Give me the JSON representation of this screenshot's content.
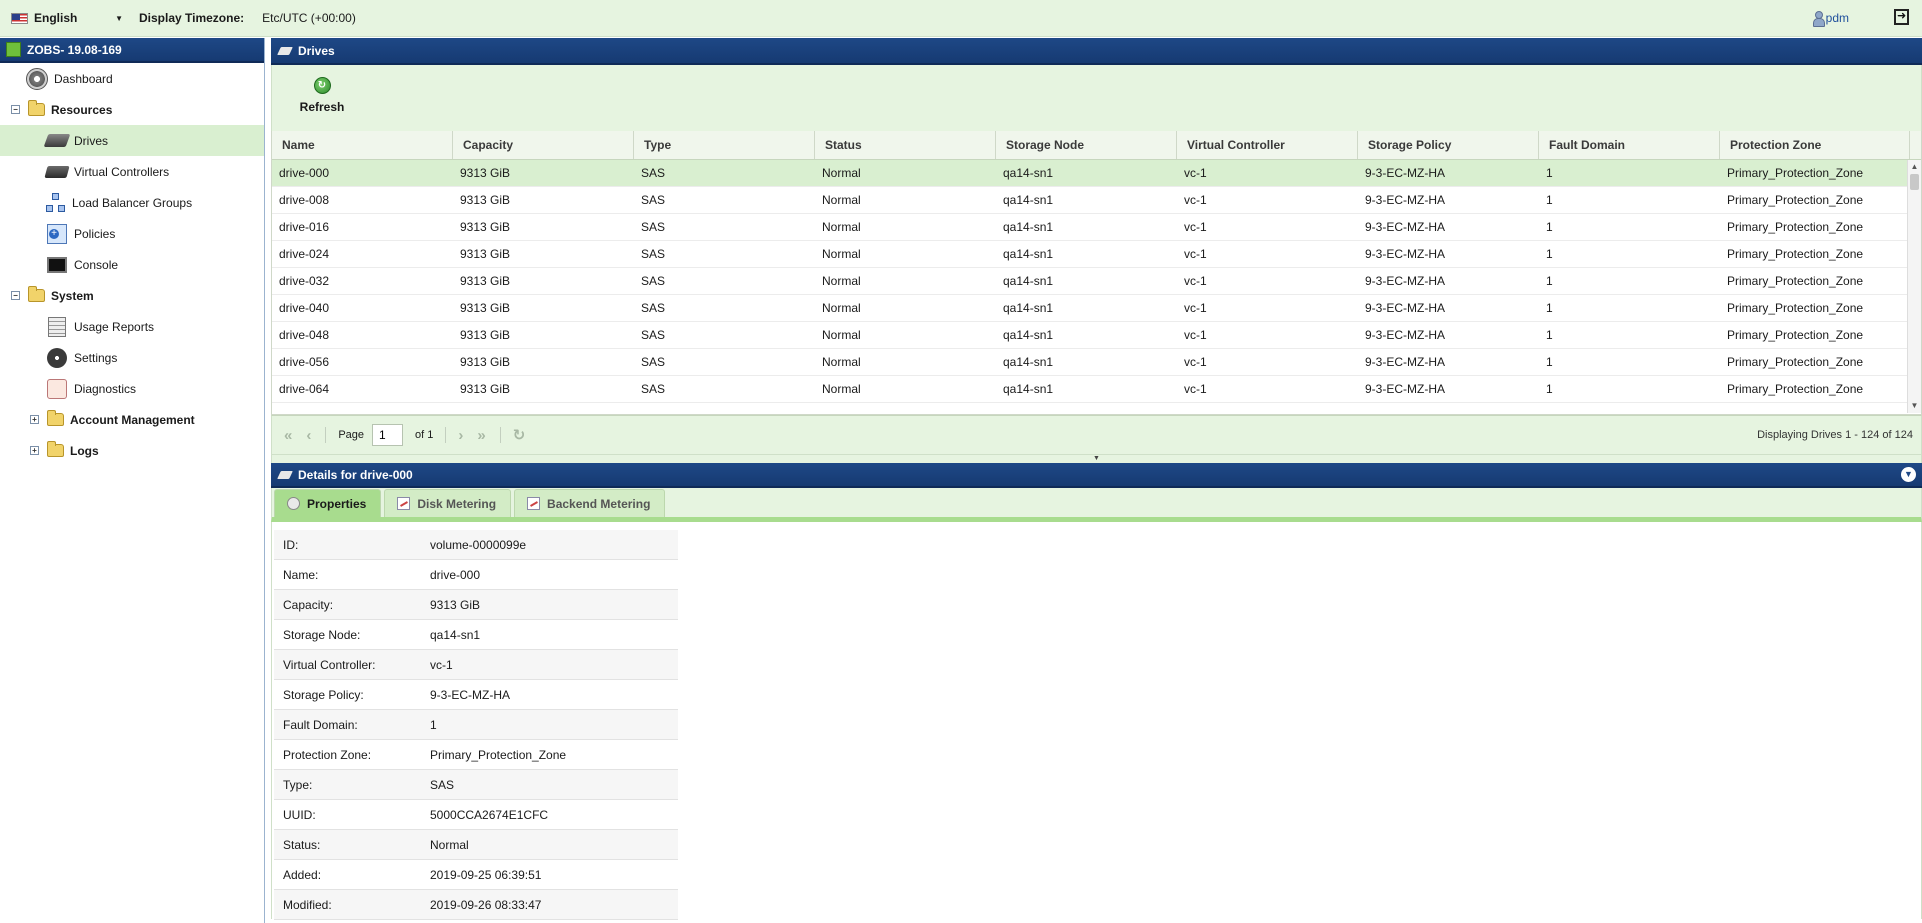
{
  "topbar": {
    "language": "English",
    "timezone_label": "Display Timezone:",
    "timezone_value": "Etc/UTC (+00:00)",
    "user": "pdm"
  },
  "sidebar": {
    "title": "ZOBS- 19.08-169",
    "items": [
      {
        "label": "Dashboard",
        "icon": "dashboard-icon"
      },
      {
        "label": "Resources",
        "icon": "folder-icon",
        "group": true
      },
      {
        "label": "Drives",
        "icon": "drive-icon",
        "selected": true
      },
      {
        "label": "Virtual Controllers",
        "icon": "virtual-controller-icon"
      },
      {
        "label": "Load Balancer Groups",
        "icon": "load-balancer-icon"
      },
      {
        "label": "Policies",
        "icon": "policy-icon"
      },
      {
        "label": "Console",
        "icon": "console-icon"
      },
      {
        "label": "System",
        "icon": "folder-icon",
        "group": true
      },
      {
        "label": "Usage Reports",
        "icon": "report-icon"
      },
      {
        "label": "Settings",
        "icon": "gear-icon"
      },
      {
        "label": "Diagnostics",
        "icon": "diagnostics-icon"
      },
      {
        "label": "Account Management",
        "icon": "folder-icon",
        "group": true
      },
      {
        "label": "Logs",
        "icon": "folder-icon",
        "group": true
      }
    ]
  },
  "drives_panel": {
    "title": "Drives",
    "refresh_label": "Refresh",
    "columns": [
      "Name",
      "Capacity",
      "Type",
      "Status",
      "Storage Node",
      "Virtual Controller",
      "Storage Policy",
      "Fault Domain",
      "Protection Zone"
    ],
    "rows": [
      [
        "drive-000",
        "9313 GiB",
        "SAS",
        "Normal",
        "qa14-sn1",
        "vc-1",
        "9-3-EC-MZ-HA",
        "1",
        "Primary_Protection_Zone"
      ],
      [
        "drive-008",
        "9313 GiB",
        "SAS",
        "Normal",
        "qa14-sn1",
        "vc-1",
        "9-3-EC-MZ-HA",
        "1",
        "Primary_Protection_Zone"
      ],
      [
        "drive-016",
        "9313 GiB",
        "SAS",
        "Normal",
        "qa14-sn1",
        "vc-1",
        "9-3-EC-MZ-HA",
        "1",
        "Primary_Protection_Zone"
      ],
      [
        "drive-024",
        "9313 GiB",
        "SAS",
        "Normal",
        "qa14-sn1",
        "vc-1",
        "9-3-EC-MZ-HA",
        "1",
        "Primary_Protection_Zone"
      ],
      [
        "drive-032",
        "9313 GiB",
        "SAS",
        "Normal",
        "qa14-sn1",
        "vc-1",
        "9-3-EC-MZ-HA",
        "1",
        "Primary_Protection_Zone"
      ],
      [
        "drive-040",
        "9313 GiB",
        "SAS",
        "Normal",
        "qa14-sn1",
        "vc-1",
        "9-3-EC-MZ-HA",
        "1",
        "Primary_Protection_Zone"
      ],
      [
        "drive-048",
        "9313 GiB",
        "SAS",
        "Normal",
        "qa14-sn1",
        "vc-1",
        "9-3-EC-MZ-HA",
        "1",
        "Primary_Protection_Zone"
      ],
      [
        "drive-056",
        "9313 GiB",
        "SAS",
        "Normal",
        "qa14-sn1",
        "vc-1",
        "9-3-EC-MZ-HA",
        "1",
        "Primary_Protection_Zone"
      ],
      [
        "drive-064",
        "9313 GiB",
        "SAS",
        "Normal",
        "qa14-sn1",
        "vc-1",
        "9-3-EC-MZ-HA",
        "1",
        "Primary_Protection_Zone"
      ]
    ],
    "pager": {
      "page_label": "Page",
      "page_value": "1",
      "of_label": "of 1",
      "info": "Displaying Drives 1 - 124 of 124"
    }
  },
  "details_panel": {
    "title": "Details for drive-000",
    "tabs": [
      "Properties",
      "Disk Metering",
      "Backend Metering"
    ],
    "properties": [
      {
        "k": "ID:",
        "v": "volume-0000099e"
      },
      {
        "k": "Name:",
        "v": "drive-000"
      },
      {
        "k": "Capacity:",
        "v": "9313 GiB"
      },
      {
        "k": "Storage Node:",
        "v": "qa14-sn1"
      },
      {
        "k": "Virtual Controller:",
        "v": "vc-1"
      },
      {
        "k": "Storage Policy:",
        "v": "9-3-EC-MZ-HA"
      },
      {
        "k": "Fault Domain:",
        "v": "1"
      },
      {
        "k": "Protection Zone:",
        "v": "Primary_Protection_Zone"
      },
      {
        "k": "Type:",
        "v": "SAS"
      },
      {
        "k": "UUID:",
        "v": "5000CCA2674E1CFC"
      },
      {
        "k": "Status:",
        "v": "Normal"
      },
      {
        "k": "Added:",
        "v": "2019-09-25 06:39:51"
      },
      {
        "k": "Modified:",
        "v": "2019-09-26 08:33:47"
      }
    ]
  },
  "colors": {
    "header_blue": "#1e4886",
    "panel_green": "#e6f4e0",
    "selected_green": "#d9efd0",
    "link_blue": "#1f4f9c"
  }
}
